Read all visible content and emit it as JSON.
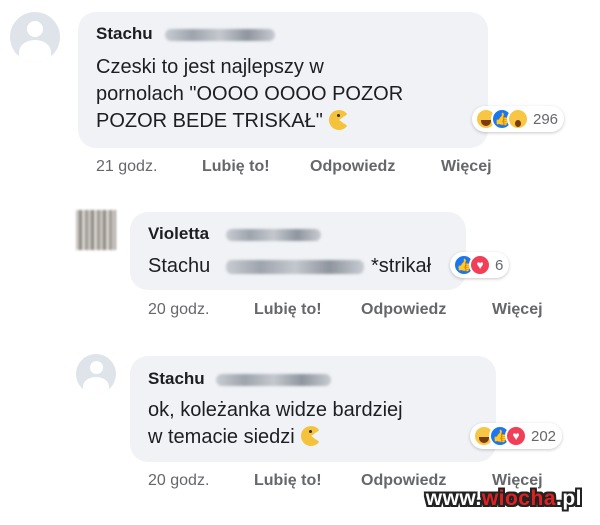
{
  "comments": [
    {
      "name": "Stachu",
      "lines": [
        "Czeski to jest najlepszy w",
        "pornolach \"OOOO OOOO POZOR",
        "POZOR BEDE TRISKAŁ\""
      ],
      "reactions": [
        "haha",
        "like",
        "wow"
      ],
      "reaction_count": "296",
      "time": "21 godz.",
      "like": "Lubię to!",
      "reply": "Odpowiedz",
      "more": "Więcej"
    },
    {
      "name": "Violetta",
      "line": "Stachu",
      "line_end": "*strikał",
      "reactions": [
        "like",
        "love"
      ],
      "reaction_count": "6",
      "time": "20 godz.",
      "like": "Lubię to!",
      "reply": "Odpowiedz",
      "more": "Więcej"
    },
    {
      "name": "Stachu",
      "lines": [
        "ok, koleżanka widze bardziej",
        "w temacie siedzi"
      ],
      "reactions": [
        "haha",
        "like",
        "love"
      ],
      "reaction_count": "202",
      "time": "20 godz.",
      "like": "Lubię to!",
      "reply": "Odpowiedz",
      "more": "Więcej"
    }
  ],
  "watermark": {
    "prefix": "www.",
    "brand": "wiocha",
    "suffix": ".pl"
  },
  "colors": {
    "bubble": "#f0f2f5",
    "meta": "#65676b",
    "like_blue": "#1877f2",
    "love_red": "#f33e58",
    "haha_yellow": "#f7c644"
  }
}
